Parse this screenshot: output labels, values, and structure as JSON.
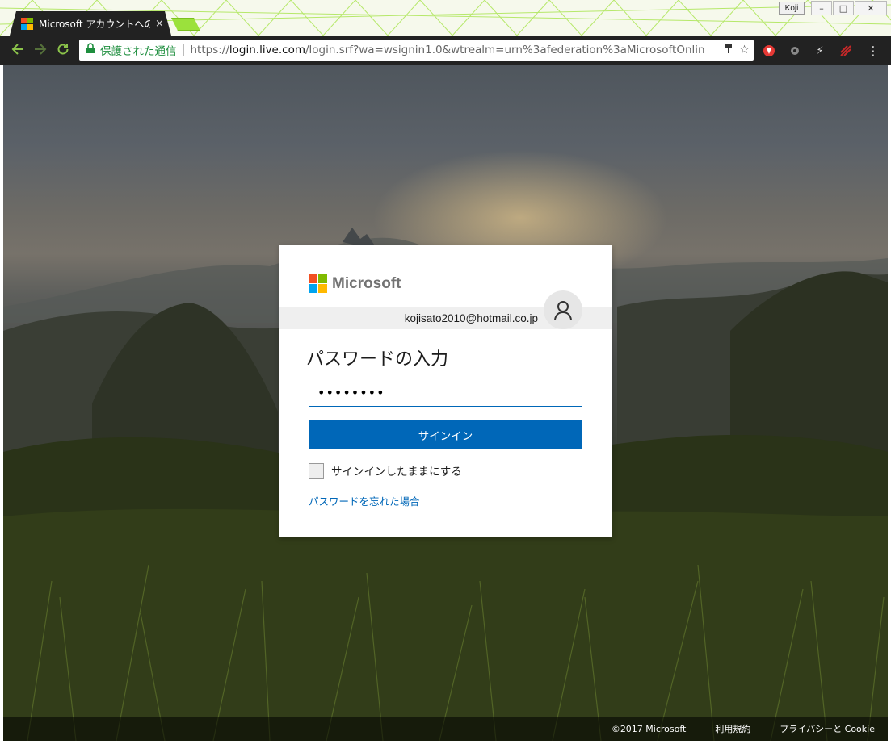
{
  "browser": {
    "profile_name": "Koji",
    "tab": {
      "title": "Microsoft アカウントへのサ",
      "close": "×"
    },
    "window_controls": {
      "minimize": "–",
      "maximize": "□",
      "close": "✕"
    },
    "omnibox": {
      "secure_label": "保護された通信",
      "url_scheme": "https://",
      "url_host": "login.live.com",
      "url_path": "/login.srf?wa=wsignin1.0&wtrealm=urn%3afederation%3aMicrosoftOnlin"
    },
    "accent": "#9be13c",
    "chrome_dark": "#222222"
  },
  "icons": {
    "back": "back-arrow-icon",
    "forward": "forward-arrow-icon",
    "reload": "reload-icon",
    "lock": "lock-icon",
    "key": "key-icon",
    "star": "bookmark-star-icon",
    "menu": "menu-dots-icon"
  },
  "login": {
    "brand": "Microsoft",
    "email": "kojisato2010@hotmail.co.jp",
    "heading": "パスワードの入力",
    "password_value": "••••••••",
    "signin_label": "サインイン",
    "keep_signed_in_label": "サインインしたままにする",
    "keep_signed_in_checked": false,
    "forgot_password_link": "パスワードを忘れた場合",
    "primary_color": "#0067b8"
  },
  "footer": {
    "copyright": "©2017 Microsoft",
    "terms": "利用規約",
    "privacy": "プライバシーと Cookie"
  },
  "brand_colors": [
    "#f25022",
    "#7fba00",
    "#00a4ef",
    "#ffb900"
  ]
}
